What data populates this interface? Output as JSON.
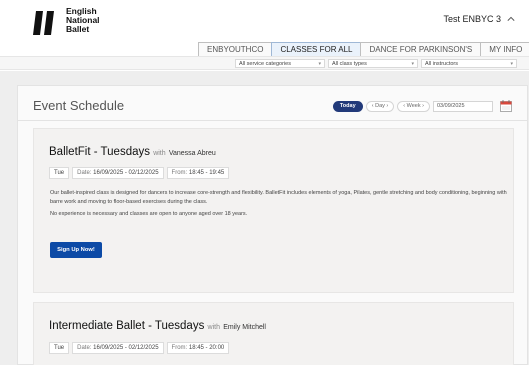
{
  "header": {
    "logo_lines": [
      "English",
      "National",
      "Ballet"
    ],
    "user_name": "Test ENBYC 3"
  },
  "tabs": [
    {
      "label": "ENBYOUTHCO",
      "active": false
    },
    {
      "label": "CLASSES FOR ALL",
      "active": true
    },
    {
      "label": "DANCE FOR PARKINSON'S",
      "active": false
    },
    {
      "label": "MY INFO",
      "active": false
    }
  ],
  "filters": {
    "categories": "All service categories",
    "types": "All class types",
    "instructors": "All instructors"
  },
  "schedule": {
    "title": "Event Schedule",
    "today_label": "Today",
    "day_label": "Day",
    "week_label": "Week",
    "date_value": "03/09/2025"
  },
  "events": [
    {
      "title": "BalletFit - Tuesdays",
      "with_label": "with",
      "instructor": "Vanessa Abreu",
      "day": "Tue",
      "date_label": "Date:",
      "date_range": "16/09/2025 - 02/12/2025",
      "from_label": "From:",
      "time_range": "18:45  - 19:45",
      "description_1": "Our ballet-inspired class is designed for dancers to increase core-strength and flexibility. BalletFit includes elements of yoga, Pilates, gentle stretching and body conditioning, beginning with barre work and moving to floor-based exercises during the class.",
      "description_2": "No experience is necessary and classes are open to anyone aged over 18 years.",
      "button_label": "Sign Up Now!"
    },
    {
      "title": "Intermediate Ballet - Tuesdays",
      "with_label": "with",
      "instructor": "Emily Mitchell",
      "day": "Tue",
      "date_label": "Date:",
      "date_range": "16/09/2025 - 02/12/2025",
      "from_label": "From:",
      "time_range": "18:45  - 20:00"
    }
  ],
  "colors": {
    "today_button": "#223a7a",
    "signup_button": "#0c4aa6",
    "active_tab": "#eaf2fb"
  }
}
